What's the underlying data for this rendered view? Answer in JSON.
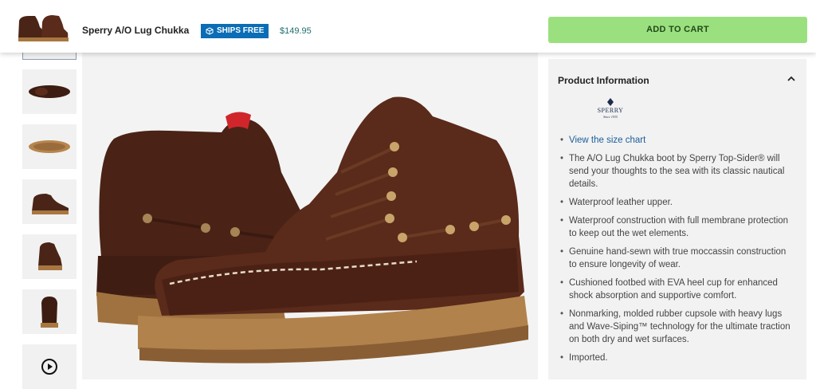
{
  "header": {
    "product_name": "Sperry A/O Lug Chukka",
    "ships_badge": "SHIPS FREE",
    "price": "$149.95",
    "add_to_cart_label": "ADD TO CART",
    "colors": {
      "cart_button": "#9be07f",
      "ships_badge": "#0a6db6",
      "price": "#206d6d"
    }
  },
  "gallery": {
    "thumbnails": [
      {
        "view": "side-pair",
        "selected": true
      },
      {
        "view": "top"
      },
      {
        "view": "sole"
      },
      {
        "view": "side"
      },
      {
        "view": "front-three-quarter"
      },
      {
        "view": "front"
      },
      {
        "view": "video",
        "icon": "play-icon"
      }
    ]
  },
  "product_info": {
    "heading": "Product Information",
    "brand_logo": "SPERRY",
    "brand_logo_sub": "Since 1935",
    "size_chart_link": "View the size chart",
    "bullets": [
      "The A/O Lug Chukka boot by Sperry Top-Sider® will send your thoughts to the sea with its classic nautical details.",
      "Waterproof leather upper.",
      "Waterproof construction with full membrane protection to keep out the wet elements.",
      "Genuine hand-sewn with true moccassin construction to ensure longevity of wear.",
      "Cushioned footbed with EVA heel cup for enhanced shock absorption and supportive comfort.",
      "Nonmarking, molded rubber cupsole with heavy lugs and Wave-Siping™ technology for the ultimate traction on both dry and wet surfaces.",
      "Imported."
    ]
  }
}
